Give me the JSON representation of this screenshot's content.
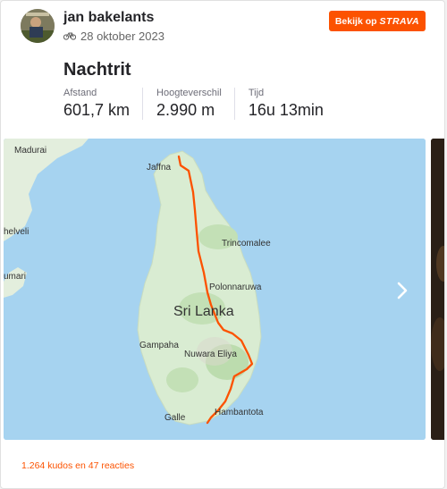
{
  "athlete": {
    "name": "jan bakelants",
    "date": "28 oktober 2023",
    "activity_icon": "bicycle-icon"
  },
  "strava_button": {
    "label": "Bekijk op",
    "brand": "STRAVA"
  },
  "activity": {
    "title": "Nachtrit"
  },
  "stats": [
    {
      "label": "Afstand",
      "value": "601,7 km"
    },
    {
      "label": "Hoogteverschil",
      "value": "2.990 m"
    },
    {
      "label": "Tijd",
      "value": "16u 13min"
    }
  ],
  "map": {
    "country_label": "Sri Lanka",
    "places": {
      "madurai": "Madurai",
      "jaffna": "Jaffna",
      "trincomalee": "Trincomalee",
      "polonnaruwa": "Polonnaruwa",
      "gampaha": "Gampaha",
      "nuwara_eliya": "Nuwara Eliya",
      "hambantota": "Hambantota",
      "galle": "Galle",
      "edge1": "helveli",
      "edge2": "umari"
    },
    "route_color": "#fc5200",
    "next_icon": "chevron-right-icon"
  },
  "footer": {
    "kudos_text": "1.264 kudos en 47 reacties"
  },
  "colors": {
    "accent": "#fc5200",
    "water": "#a6d3f0",
    "land": "#d9ecd2"
  }
}
